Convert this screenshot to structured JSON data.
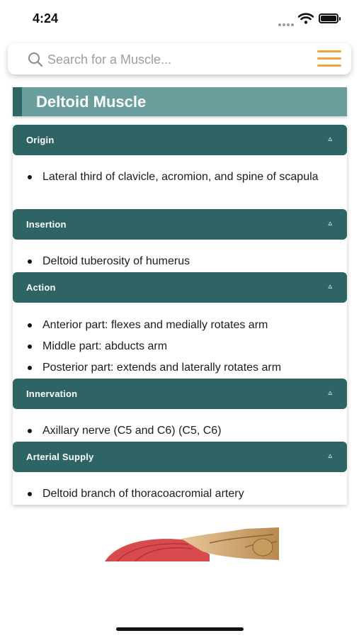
{
  "status_bar": {
    "time": "4:24"
  },
  "search": {
    "placeholder": "Search for a Muscle...",
    "value": ""
  },
  "title": "Deltoid Muscle",
  "sections": [
    {
      "label": "Origin",
      "arrow": "▵",
      "items": [
        "Lateral third of clavicle, acromion, and spine of scapula"
      ]
    },
    {
      "label": "Insertion",
      "arrow": "▵",
      "items": [
        "Deltoid tuberosity of humerus"
      ]
    },
    {
      "label": "Action",
      "arrow": "▵",
      "items": [
        "Anterior part: flexes and medially rotates arm",
        "Middle part: abducts arm",
        "Posterior part: extends and laterally rotates arm"
      ]
    },
    {
      "label": "Innervation",
      "arrow": "▵",
      "items": [
        "Axillary nerve (C5 and C6) (C5, C6)"
      ]
    },
    {
      "label": "Arterial Supply",
      "arrow": "▵",
      "items": [
        "Deltoid branch of thoracoacromial artery"
      ]
    }
  ],
  "colors": {
    "header": "#2e6464",
    "title_bar": "#6a9e9c",
    "title_accent": "#2f6767",
    "menu": "#f0a33a"
  },
  "icons": {
    "search": "search-icon",
    "menu": "hamburger-menu-icon",
    "collapse": "triangle-up-icon"
  }
}
